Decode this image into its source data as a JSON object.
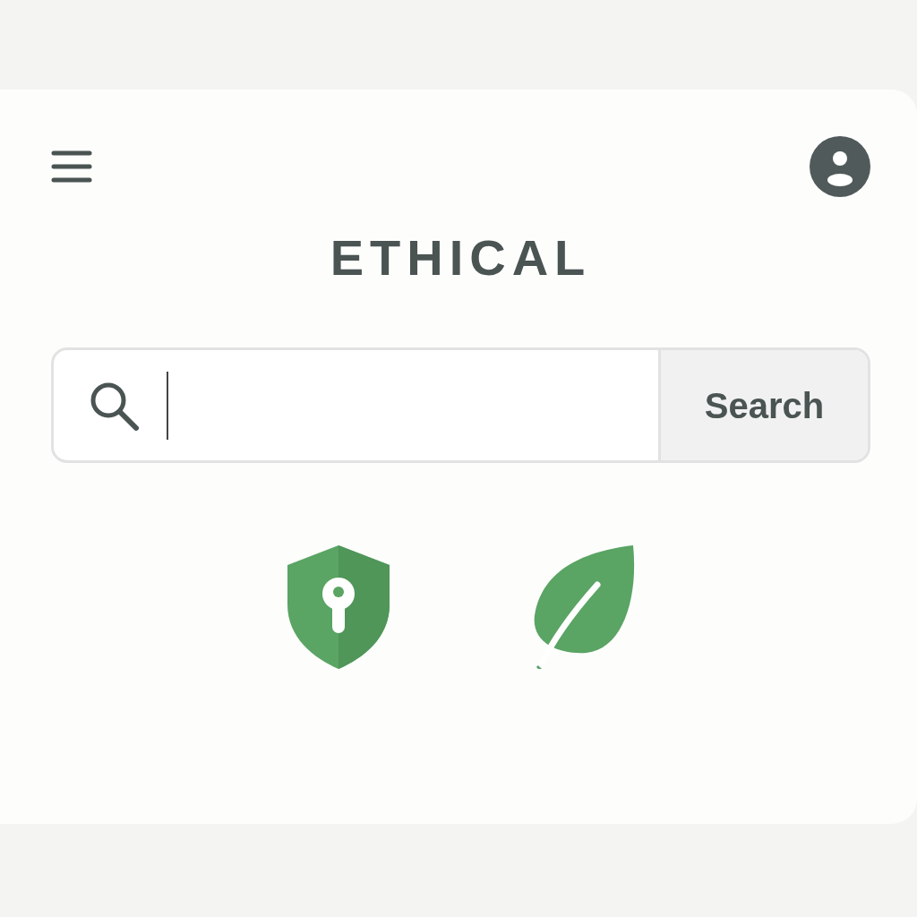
{
  "title": "ETHICAL",
  "search": {
    "button": "Search"
  }
}
